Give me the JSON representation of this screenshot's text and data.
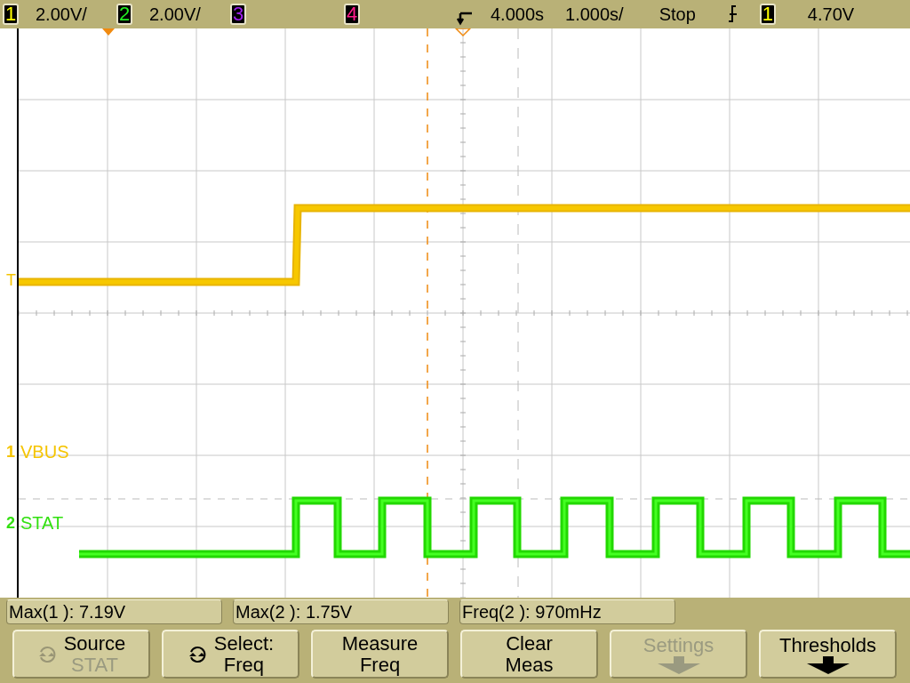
{
  "channels": [
    {
      "number": "1",
      "scale": "2.00V/"
    },
    {
      "number": "2",
      "scale": "2.00V/"
    },
    {
      "number": "3"
    },
    {
      "number": "4"
    }
  ],
  "timebase": {
    "delay": "4.000s",
    "scale": "1.000s/",
    "run_state": "Stop"
  },
  "trigger": {
    "source": "1",
    "level": "4.70V",
    "marker": "T"
  },
  "trace_labels": [
    {
      "number": "1",
      "name": "VBUS",
      "color": "#f5c400"
    },
    {
      "number": "2",
      "name": "STAT",
      "color": "#33e011"
    }
  ],
  "measurements": [
    "Max(1 ): 7.19V",
    "Max(2 ): 1.75V",
    "Freq(2 ): 970mHz"
  ],
  "softkeys": [
    {
      "kind": "knob",
      "label": "Source",
      "value": "STAT",
      "knob_active": false,
      "disabled": false
    },
    {
      "kind": "knob",
      "label": "Select:",
      "value": "Freq",
      "knob_active": true,
      "disabled": false
    },
    {
      "kind": "plain",
      "label": "Measure",
      "value": "Freq",
      "disabled": false
    },
    {
      "kind": "plain",
      "label": "Clear",
      "value": "Meas",
      "disabled": false
    },
    {
      "kind": "menu",
      "label": "Settings",
      "disabled": true
    },
    {
      "kind": "menu",
      "label": "Thresholds",
      "disabled": false
    }
  ]
}
